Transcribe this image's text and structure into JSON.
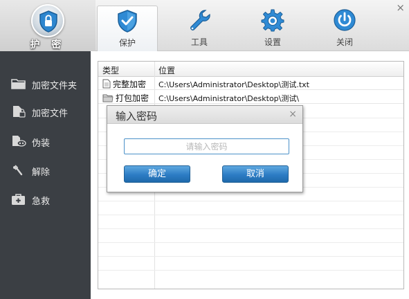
{
  "window": {
    "close_glyph": "×"
  },
  "logo": {
    "text": "护 密",
    "icon": "shield-lock-icon"
  },
  "tabs": [
    {
      "label": "保护",
      "icon": "shield-check-icon",
      "active": true
    },
    {
      "label": "工具",
      "icon": "wrench-icon",
      "active": false
    },
    {
      "label": "设置",
      "icon": "gear-icon",
      "active": false
    },
    {
      "label": "关闭",
      "icon": "power-icon",
      "active": false
    }
  ],
  "sidebar": {
    "items": [
      {
        "label": "加密文件夹",
        "icon": "folder-icon"
      },
      {
        "label": "加密文件",
        "icon": "file-lock-icon"
      },
      {
        "label": "伪装",
        "icon": "disguise-icon"
      },
      {
        "label": "解除",
        "icon": "unlock-icon"
      },
      {
        "label": "急救",
        "icon": "first-aid-icon"
      }
    ]
  },
  "table": {
    "columns": [
      "类型",
      "位置"
    ],
    "rows": [
      {
        "type": "完整加密",
        "path": "C:\\Users\\Administrator\\Desktop\\测试.txt",
        "icon": "document-icon"
      },
      {
        "type": "打包加密",
        "path": "C:\\Users\\Administrator\\Desktop\\测试\\",
        "icon": "folder-icon"
      }
    ]
  },
  "dialog": {
    "title": "输入密码",
    "close_glyph": "×",
    "password_placeholder": "请输入密码",
    "password_value": "",
    "ok_label": "确定",
    "cancel_label": "取消"
  },
  "colors": {
    "sidebar_bg": "#3b3f44",
    "accent_blue": "#2c7cc4",
    "input_border": "#4a90c8"
  }
}
